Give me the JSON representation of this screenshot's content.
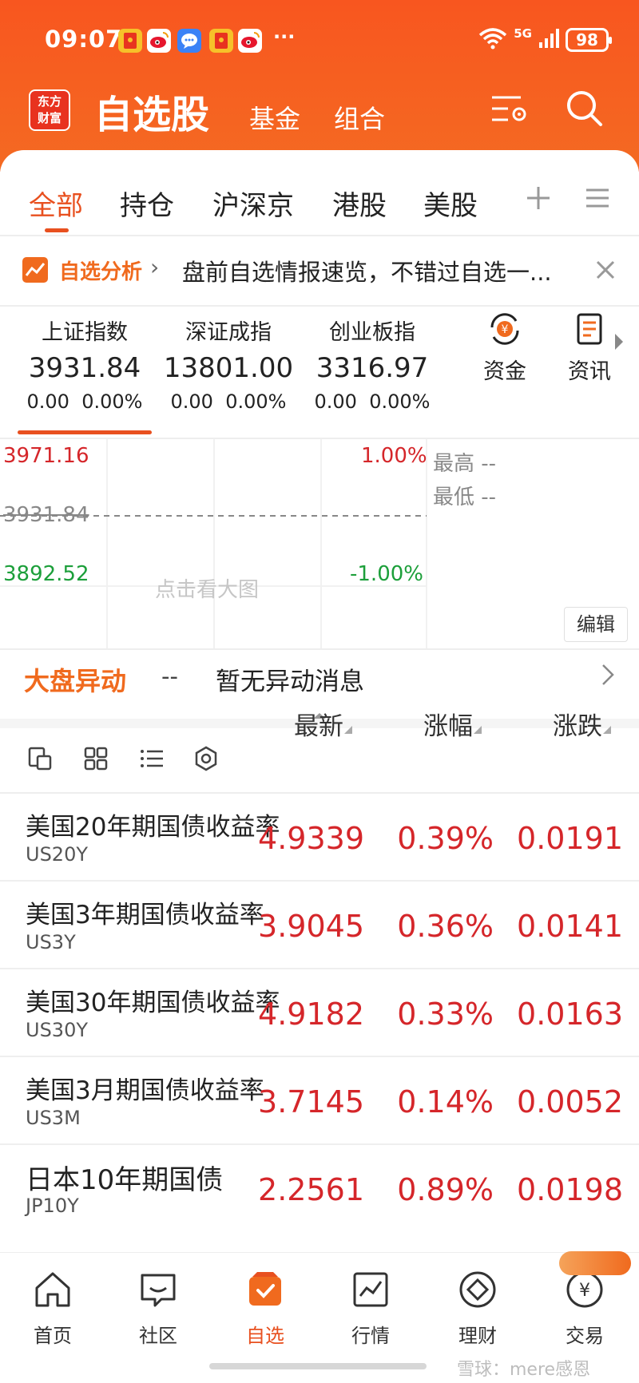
{
  "status_bar": {
    "time": "09:07",
    "more": "···",
    "network": "5G",
    "battery": "98"
  },
  "header": {
    "logo_text_1": "东方",
    "logo_text_2": "财富",
    "title": "自选股",
    "tabs": [
      "基金",
      "组合"
    ]
  },
  "market_tabs": [
    "全部",
    "持仓",
    "沪深京",
    "港股",
    "美股"
  ],
  "banner": {
    "title": "自选分析",
    "text": "盘前自选情报速览，不错过自选一..."
  },
  "indices": [
    {
      "name": "上证指数",
      "value": "3931.84",
      "change": "0.00",
      "pct": "0.00%"
    },
    {
      "name": "深证成指",
      "value": "13801.00",
      "change": "0.00",
      "pct": "0.00%"
    },
    {
      "name": "创业板指",
      "value": "3316.97",
      "change": "0.00",
      "pct": "0.00%"
    }
  ],
  "side_buttons": [
    {
      "label": "资金",
      "icon": "yuan-circle-icon"
    },
    {
      "label": "资讯",
      "icon": "news-doc-icon"
    }
  ],
  "chart": {
    "upper_price": "3971.16",
    "base_price": "3931.84",
    "lower_price": "3892.52",
    "upper_pct": "1.00%",
    "lower_pct": "-1.00%",
    "high_label": "最高",
    "high_value": "--",
    "low_label": "最低",
    "low_value": "--",
    "hint": "点击看大图",
    "edit_label": "编辑"
  },
  "market_move": {
    "title": "大盘异动",
    "dash": "--",
    "text": "暂无异动消息"
  },
  "table": {
    "headers": [
      "最新",
      "涨幅",
      "涨跌"
    ],
    "rows": [
      {
        "name": "美国20年期国债收益率",
        "code": "US20Y",
        "latest": "4.9339",
        "pct": "0.39%",
        "chg": "0.0191"
      },
      {
        "name": "美国3年期国债收益率",
        "code": "US3Y",
        "latest": "3.9045",
        "pct": "0.36%",
        "chg": "0.0141"
      },
      {
        "name": "美国30年期国债收益率",
        "code": "US30Y",
        "latest": "4.9182",
        "pct": "0.33%",
        "chg": "0.0163"
      },
      {
        "name": "美国3月期国债收益率",
        "code": "US3M",
        "latest": "3.7145",
        "pct": "0.14%",
        "chg": "0.0052"
      },
      {
        "name": "日本10年期国债",
        "code": "JP10Y",
        "latest": "2.2561",
        "pct": "0.89%",
        "chg": "0.0198"
      }
    ]
  },
  "bottom_nav": [
    "首页",
    "社区",
    "自选",
    "行情",
    "理财",
    "交易"
  ],
  "watermark": "雪球：mere感恩",
  "colors": {
    "brand_orange": "#f8561f",
    "up_red": "#d5262a",
    "down_green": "#1c9f3a",
    "accent": "#e8501f"
  }
}
